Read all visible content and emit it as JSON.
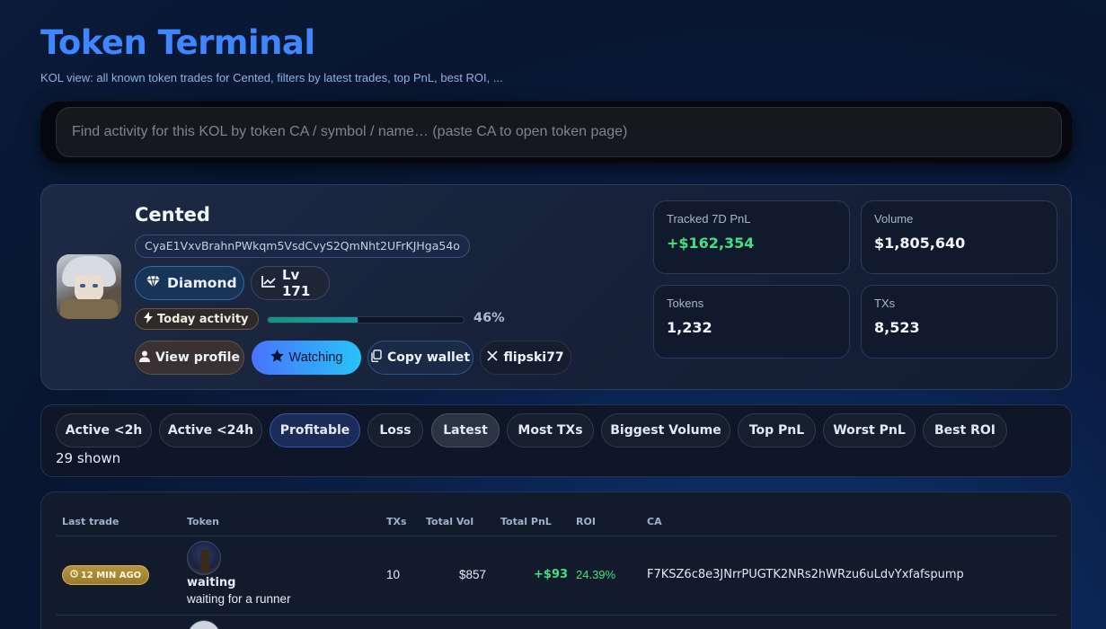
{
  "header": {
    "title": "Token Terminal",
    "subtitle": "KOL view: all known token trades for Cented, filters by latest trades, top PnL, best ROI, ..."
  },
  "search": {
    "placeholder": "Find activity for this KOL by token CA / symbol / name… (paste CA to open token page)",
    "value": ""
  },
  "profile": {
    "name": "Cented",
    "wallet": "CyaE1VxvBrahnPWkqm5VsdCvyS2QmNht2UFrKJHga54o",
    "tier": "Diamond",
    "level": "Lv 171",
    "activity_label": "Today activity",
    "activity_pct": "46%",
    "activity_fraction": 0.46,
    "buttons": {
      "view_profile": "View profile",
      "watching": "Watching",
      "copy_wallet": "Copy wallet",
      "x_handle": "flipski77"
    }
  },
  "stats": [
    {
      "label": "Tracked 7D PnL",
      "value": "+$162,354",
      "positive": true
    },
    {
      "label": "Volume",
      "value": "$1,805,640",
      "positive": false
    },
    {
      "label": "Tokens",
      "value": "1,232",
      "positive": false
    },
    {
      "label": "TXs",
      "value": "8,523",
      "positive": false
    }
  ],
  "filters": {
    "chips": [
      "Active <2h",
      "Active <24h",
      "Profitable",
      "Loss",
      "Latest",
      "Most TXs",
      "Biggest Volume",
      "Top PnL",
      "Worst PnL",
      "Best ROI"
    ],
    "shown": "29 shown"
  },
  "table": {
    "columns": [
      "Last trade",
      "Token",
      "TXs",
      "Total Vol",
      "Total PnL",
      "ROI",
      "CA"
    ],
    "rows": [
      {
        "last_trade": "12 MIN AGO",
        "token_symbol": "waiting",
        "token_name": "waiting for a runner",
        "txs": "10",
        "total_vol": "$857",
        "total_pnl": "+$93",
        "roi": "24.39%",
        "ca": "F7KSZ6c8e3JNrrPUGTK2NRs2hWRzu6uLdvYxfafspump"
      }
    ]
  },
  "colors": {
    "accent": "#3f86ff",
    "positive": "#43e082",
    "background": "#0a1a38"
  }
}
